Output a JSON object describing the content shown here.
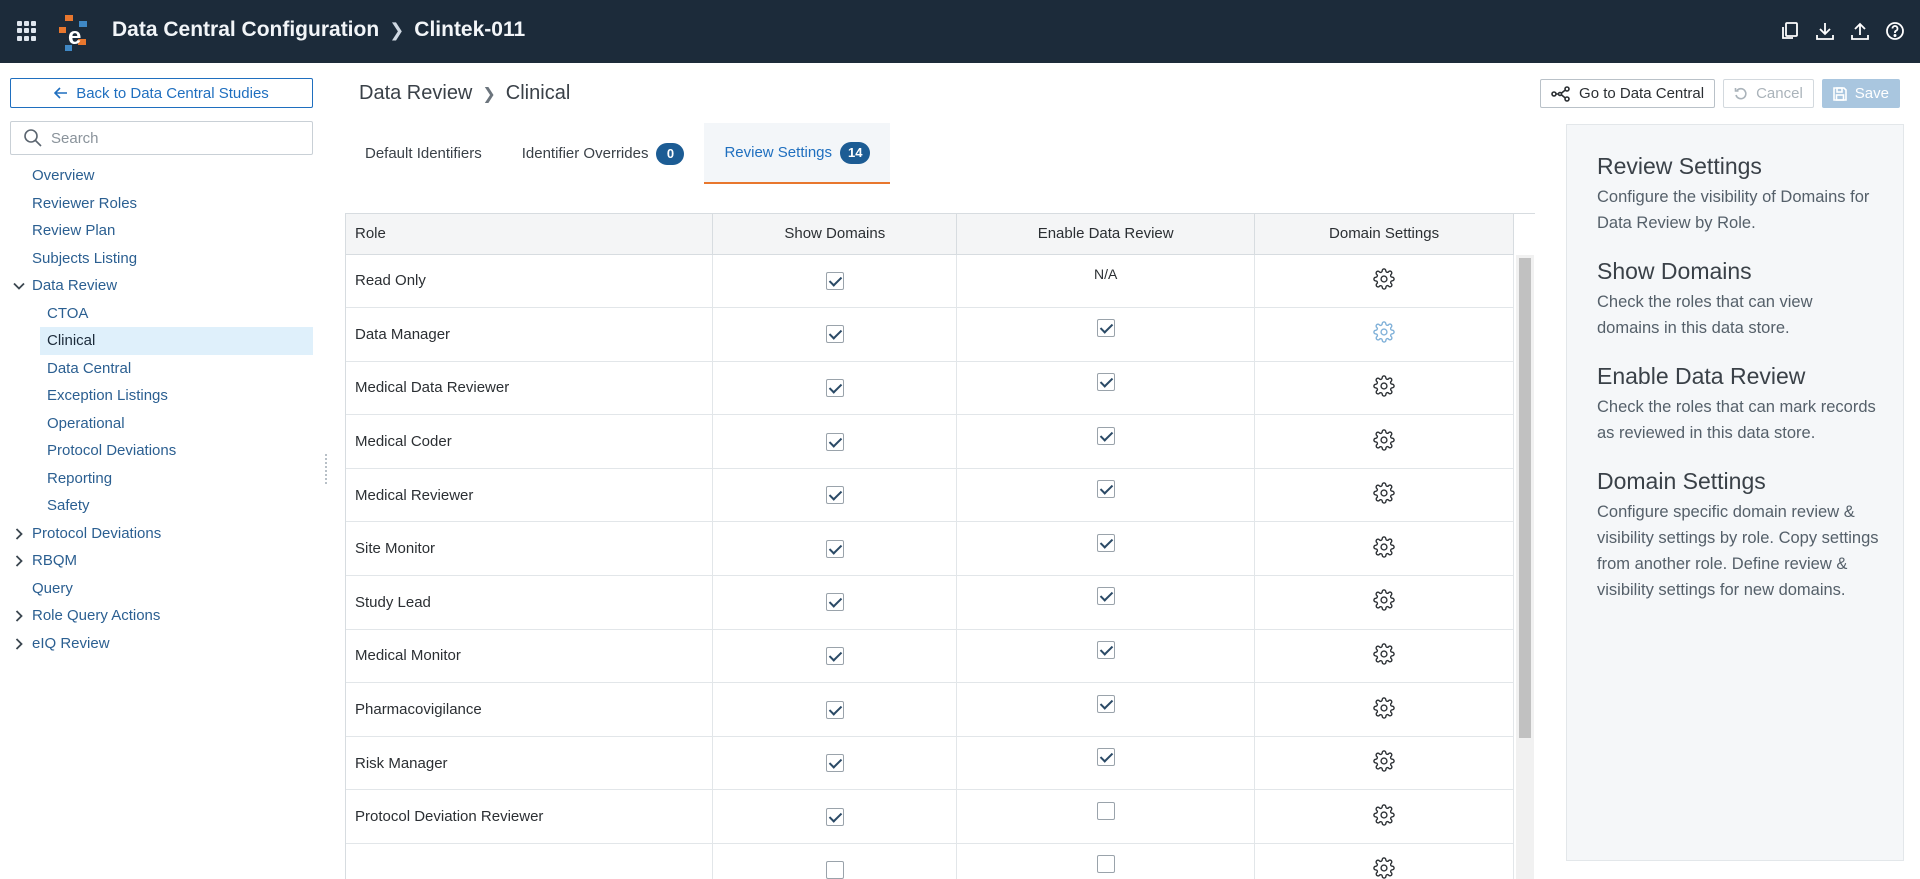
{
  "app": {
    "title": "Data Central Configuration",
    "study": "Clintek-011"
  },
  "top_icons": [
    "copy-icon",
    "download-icon",
    "upload-icon",
    "help-icon"
  ],
  "sidebar": {
    "back_label": "Back to Data Central Studies",
    "search_placeholder": "Search",
    "items": [
      {
        "label": "Overview",
        "level": 1
      },
      {
        "label": "Reviewer Roles",
        "level": 1
      },
      {
        "label": "Review Plan",
        "level": 1
      },
      {
        "label": "Subjects Listing",
        "level": 1
      },
      {
        "label": "Data Review",
        "level": 1,
        "expanded": true
      },
      {
        "label": "CTOA",
        "level": 2
      },
      {
        "label": "Clinical",
        "level": 2,
        "active": true
      },
      {
        "label": "Data Central",
        "level": 2
      },
      {
        "label": "Exception Listings",
        "level": 2
      },
      {
        "label": "Operational",
        "level": 2
      },
      {
        "label": "Protocol Deviations",
        "level": 2
      },
      {
        "label": "Reporting",
        "level": 2
      },
      {
        "label": "Safety",
        "level": 2
      },
      {
        "label": "Protocol Deviations",
        "level": 1,
        "collapsed": true
      },
      {
        "label": "RBQM",
        "level": 1,
        "collapsed": true
      },
      {
        "label": "Query",
        "level": 1
      },
      {
        "label": "Role Query Actions",
        "level": 1,
        "collapsed": true
      },
      {
        "label": "eIQ Review",
        "level": 1,
        "collapsed": true
      }
    ]
  },
  "breadcrumb": {
    "parent": "Data Review",
    "current": "Clinical"
  },
  "actions": {
    "go_to": "Go to Data Central",
    "cancel": "Cancel",
    "save": "Save"
  },
  "tabs": [
    {
      "label": "Default Identifiers"
    },
    {
      "label": "Identifier Overrides",
      "badge": "0"
    },
    {
      "label": "Review Settings",
      "badge": "14",
      "active": true
    }
  ],
  "table": {
    "headers": [
      "Role",
      "Show Domains",
      "Enable Data Review",
      "Domain Settings"
    ],
    "rows": [
      {
        "role": "Read Only",
        "show": true,
        "review": "N/A"
      },
      {
        "role": "Data Manager",
        "show": true,
        "review": true,
        "gear_hover": true
      },
      {
        "role": "Medical Data Reviewer",
        "show": true,
        "review": true
      },
      {
        "role": "Medical Coder",
        "show": true,
        "review": true
      },
      {
        "role": "Medical Reviewer",
        "show": true,
        "review": true
      },
      {
        "role": "Site Monitor",
        "show": true,
        "review": true
      },
      {
        "role": "Study Lead",
        "show": true,
        "review": true
      },
      {
        "role": "Medical Monitor",
        "show": true,
        "review": true
      },
      {
        "role": "Pharmacovigilance",
        "show": true,
        "review": true
      },
      {
        "role": "Risk Manager",
        "show": true,
        "review": true
      },
      {
        "role": "Protocol Deviation Reviewer",
        "show": true,
        "review": false
      },
      {
        "role": "",
        "show": false,
        "review": false
      }
    ]
  },
  "help": {
    "sections": [
      {
        "title": "Review Settings",
        "text": "Configure the visibility of Domains for Data Review by Role."
      },
      {
        "title": "Show Domains",
        "text": "Check the roles that can view domains in this data store."
      },
      {
        "title": "Enable Data Review",
        "text": "Check the roles that can mark records as reviewed in this data store."
      },
      {
        "title": "Domain Settings",
        "text": "Configure specific domain review & visibility settings by role. Copy settings from another role. Define review & visibility settings for new domains."
      }
    ]
  }
}
